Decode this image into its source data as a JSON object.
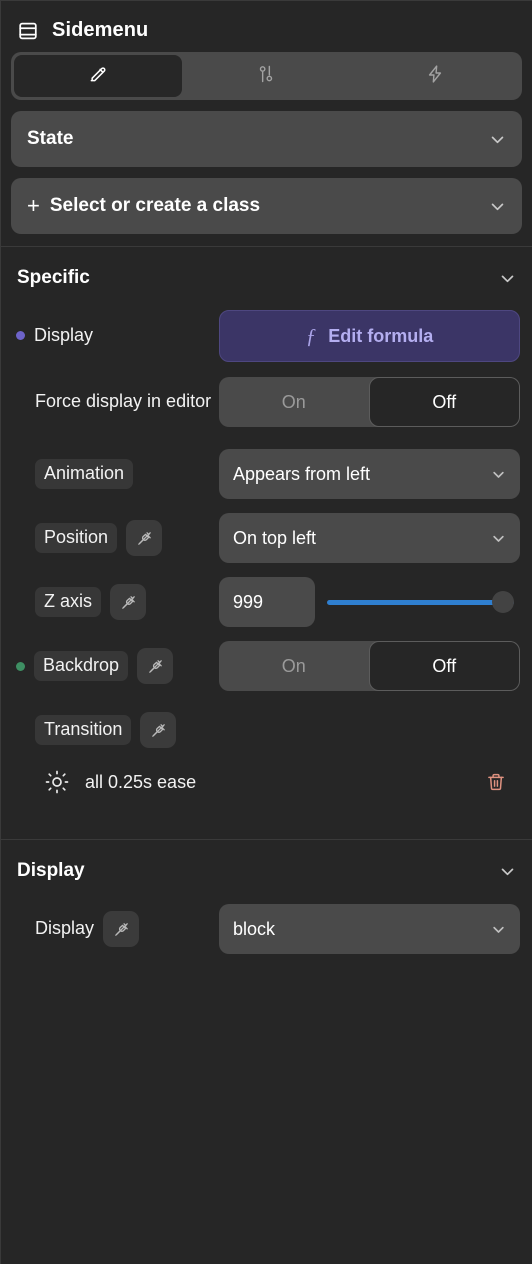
{
  "header": {
    "title": "Sidemenu",
    "icon": "panel-layout-icon"
  },
  "tabs": [
    {
      "name": "edit-tab",
      "icon": "pencil-icon",
      "active": true
    },
    {
      "name": "settings-tab",
      "icon": "sliders-icon",
      "active": false
    },
    {
      "name": "actions-tab",
      "icon": "lightning-icon",
      "active": false
    }
  ],
  "state_selector": {
    "label": "State"
  },
  "class_selector": {
    "plus": "+",
    "label": "Select or create a class"
  },
  "sections": {
    "specific": {
      "title": "Specific",
      "rows": {
        "display": {
          "label": "Display",
          "dot_color": "#6d63c9",
          "formula_button": "Edit formula",
          "formula_symbol": "ƒ"
        },
        "force_display": {
          "label": "Force display in editor",
          "toggle": {
            "on": "On",
            "off": "Off",
            "selected": "Off"
          }
        },
        "animation": {
          "label": "Animation",
          "value": "Appears from left"
        },
        "position": {
          "label": "Position",
          "value": "On top left"
        },
        "z_axis": {
          "label": "Z axis",
          "value": "999",
          "slider_percent": 100,
          "slider_color": "#2f7fd0"
        },
        "backdrop": {
          "label": "Backdrop",
          "dot_color": "#3e8f63",
          "toggle": {
            "on": "On",
            "off": "Off",
            "selected": "Off"
          }
        },
        "transition": {
          "label": "Transition",
          "item": "all 0.25s ease"
        }
      }
    },
    "display": {
      "title": "Display",
      "rows": {
        "display": {
          "label": "Display",
          "value": "block"
        }
      }
    }
  }
}
